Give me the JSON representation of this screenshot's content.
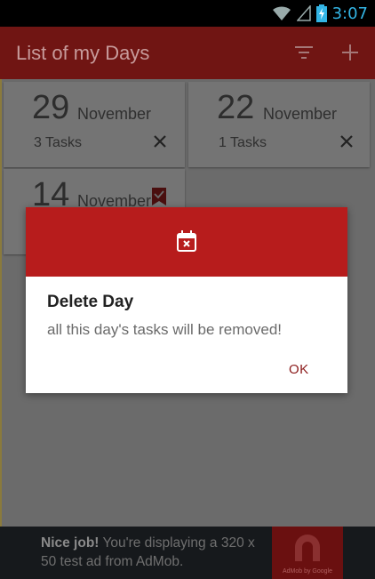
{
  "status_bar": {
    "time": "3:07"
  },
  "app_bar": {
    "title": "List of my Days"
  },
  "days": [
    {
      "day": "29",
      "month": "November",
      "tasks": "3 Tasks"
    },
    {
      "day": "22",
      "month": "November",
      "tasks": "1 Tasks"
    },
    {
      "day": "14",
      "month": "November"
    }
  ],
  "dialog": {
    "title": "Delete Day",
    "message": "all this day's tasks will be removed!",
    "ok_label": "OK"
  },
  "ad": {
    "bold": "Nice job!",
    "text": " You're displaying a 320 x 50 test ad from AdMob.",
    "logo_text": "AdMob by Google"
  },
  "colors": {
    "primary": "#b71c1c",
    "status_time": "#33b5e5"
  },
  "icons": {
    "dialog_header": "calendar-remove-icon",
    "filter": "filter-icon",
    "add": "plus-icon",
    "delete": "close-icon",
    "bookmark": "bookmark-check-icon"
  }
}
